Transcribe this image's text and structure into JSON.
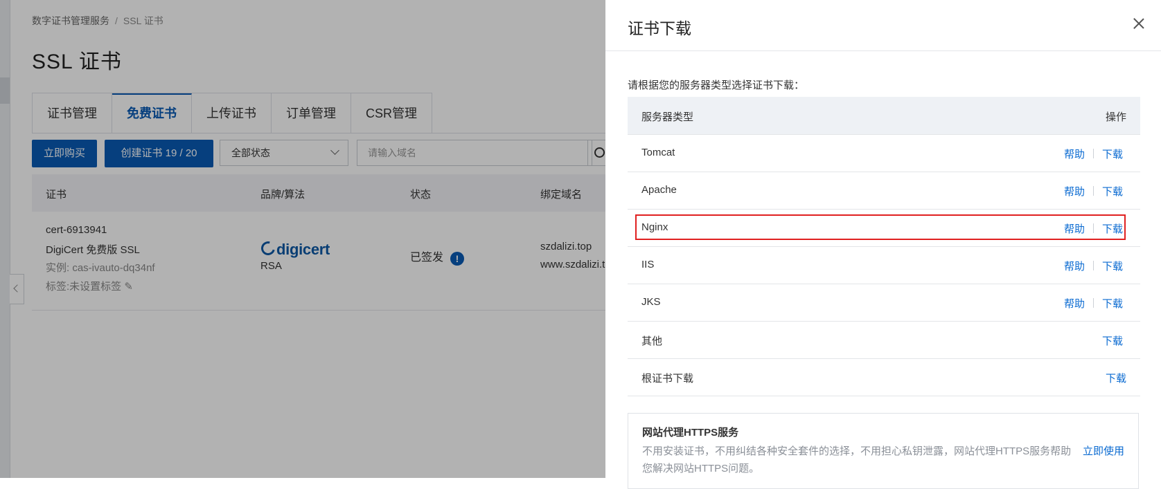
{
  "breadcrumb": {
    "parent": "数字证书管理服务",
    "separator": "/",
    "current": "SSL 证书"
  },
  "page": {
    "title": "SSL 证书"
  },
  "tabs": [
    {
      "label": "证书管理"
    },
    {
      "label": "免费证书"
    },
    {
      "label": "上传证书"
    },
    {
      "label": "订单管理"
    },
    {
      "label": "CSR管理"
    }
  ],
  "toolbar": {
    "buy_label": "立即购买",
    "create_label": "创建证书 19 / 20",
    "status_value": "全部状态",
    "search_placeholder": "请输入域名"
  },
  "cert_table": {
    "headers": [
      "证书",
      "品牌/算法",
      "状态",
      "绑定域名"
    ],
    "row": {
      "cert_id": "cert-6913941",
      "cert_name": "DigiCert 免费版 SSL",
      "instance": "实例: cas-ivauto-dq34nf",
      "tags": "标签:未设置标签",
      "brand": "digicert",
      "algorithm": "RSA",
      "status": "已签发",
      "domain1": "szdalizi.top",
      "domain2": "www.szdalizi.t"
    }
  },
  "drawer": {
    "title": "证书下载",
    "intro": "请根据您的服务器类型选择证书下载：",
    "table_header_type": "服务器类型",
    "table_header_action": "操作",
    "help_label": "帮助",
    "download_label": "下载",
    "servers": [
      {
        "name": "Tomcat"
      },
      {
        "name": "Apache"
      },
      {
        "name": "Nginx"
      },
      {
        "name": "IIS"
      },
      {
        "name": "JKS"
      },
      {
        "name": "其他"
      },
      {
        "name": "根证书下载"
      }
    ],
    "promo": {
      "title": "网站代理HTTPS服务",
      "desc": "不用安装证书，不用纠结各种安全套件的选择，不用担心私钥泄露，网站代理HTTPS服务帮助您解决网站HTTPS问题。",
      "link": "立即使用"
    }
  },
  "colors": {
    "primary": "#0a5bb5",
    "link": "#0a6ad1",
    "highlight": "#e02020"
  }
}
